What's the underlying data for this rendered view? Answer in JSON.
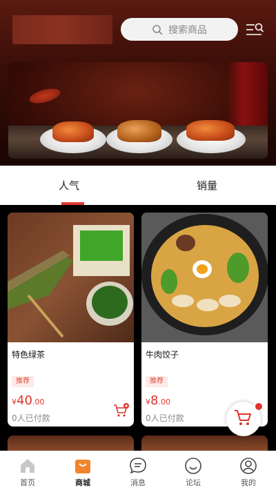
{
  "search": {
    "placeholder": "搜索商品"
  },
  "tabs": [
    {
      "label": "人气"
    },
    {
      "label": "销量"
    }
  ],
  "products": [
    {
      "name": "特色绿茶",
      "badge": "推荐",
      "price_symbol": "¥",
      "price_int": "40",
      "price_dec": ".00",
      "paid": "0人已付款"
    },
    {
      "name": "牛肉饺子",
      "badge": "推荐",
      "price_symbol": "¥",
      "price_int": "8",
      "price_dec": ".00",
      "paid": "0人已付款"
    }
  ],
  "nav": [
    {
      "label": "首页",
      "icon": "home-icon"
    },
    {
      "label": "商城",
      "icon": "shopping-bag-icon"
    },
    {
      "label": "消息",
      "icon": "message-icon"
    },
    {
      "label": "论坛",
      "icon": "forum-smile-icon"
    },
    {
      "label": "我的",
      "icon": "profile-icon"
    }
  ],
  "colors": {
    "accent": "#e0342a",
    "active_nav": "#f0852d"
  }
}
